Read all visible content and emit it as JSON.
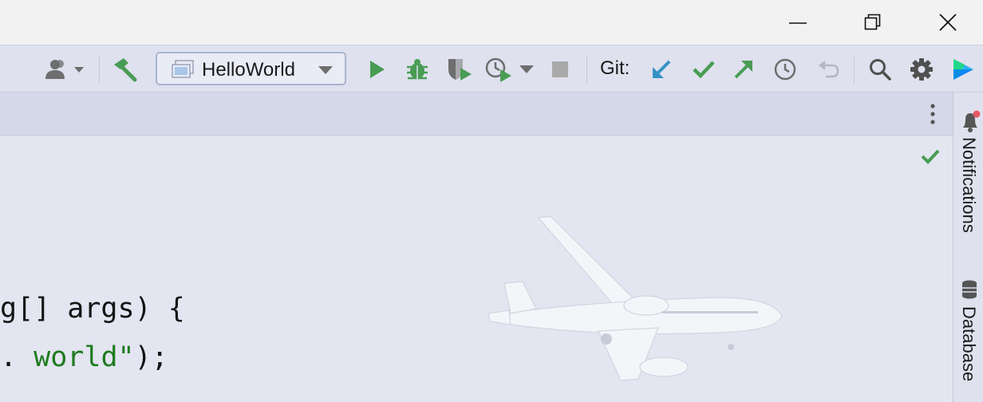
{
  "window": {
    "minimize_icon": "minimize-icon",
    "restore_icon": "restore-icon",
    "close_icon": "close-icon"
  },
  "toolbar": {
    "run_config": {
      "label": "HelloWorld",
      "icon": "application-window-icon"
    },
    "git_label": "Git:",
    "icons": [
      "profile-icon",
      "build-hammer-icon",
      "run-icon",
      "debug-icon",
      "coverage-icon",
      "profiler-icon",
      "stop-icon",
      "update-project-icon",
      "commit-icon",
      "push-icon",
      "history-icon",
      "rollback-icon",
      "search-icon",
      "settings-icon",
      "ide-logo-icon"
    ],
    "colors": {
      "run_green": "#499c54",
      "git_blue": "#3592c4",
      "git_green": "#499c54",
      "disabled": "#a9a9a9"
    }
  },
  "editor": {
    "line1": "g[] args) {",
    "line2_prefix": ". ",
    "line2_string": "world\"",
    "line2_suffix": ");",
    "inspection_status_icon": "checkmark-icon"
  },
  "right_sidebar": {
    "notifications": "Notifications",
    "database": "Database"
  }
}
